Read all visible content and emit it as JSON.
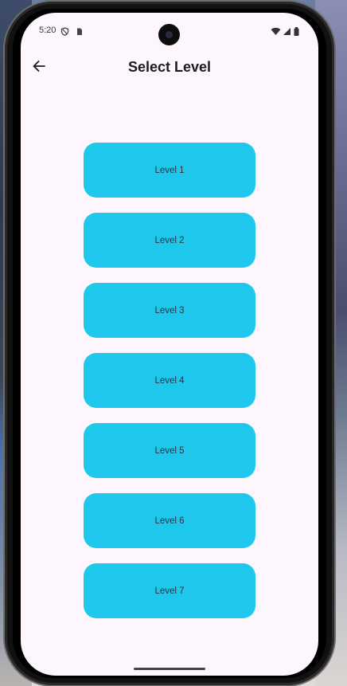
{
  "status_bar": {
    "time": "5:20"
  },
  "app_bar": {
    "title": "Select Level",
    "back_icon": "arrow-left-icon"
  },
  "levels": [
    {
      "label": "Level 1"
    },
    {
      "label": "Level 2"
    },
    {
      "label": "Level 3"
    },
    {
      "label": "Level 4"
    },
    {
      "label": "Level 5"
    },
    {
      "label": "Level 6"
    },
    {
      "label": "Level 7"
    }
  ],
  "colors": {
    "background": "#fdf7fd",
    "level_button": "#1dc8ec",
    "title_text": "#1d1b20"
  }
}
